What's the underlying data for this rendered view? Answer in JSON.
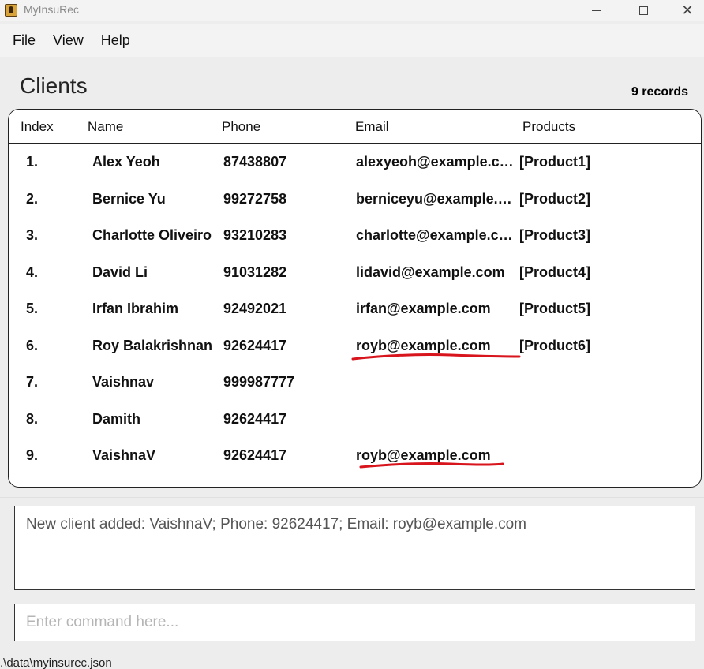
{
  "window": {
    "title": "MyInsuRec",
    "minimize_icon": "minimize-icon",
    "maximize_icon": "maximize-icon",
    "close_icon": "close-icon"
  },
  "menu": {
    "items": [
      "File",
      "View",
      "Help"
    ]
  },
  "clients_panel": {
    "title": "Clients",
    "record_count": "9 records",
    "columns": {
      "index": "Index",
      "name": "Name",
      "phone": "Phone",
      "email": "Email",
      "products": "Products"
    },
    "rows": [
      {
        "index": "1.",
        "name": "Alex Yeoh",
        "phone": "87438807",
        "email": "alexyeoh@example.com",
        "products": "[Product1]"
      },
      {
        "index": "2.",
        "name": "Bernice Yu",
        "phone": "99272758",
        "email": "berniceyu@example.com",
        "products": "[Product2]"
      },
      {
        "index": "3.",
        "name": "Charlotte Oliveiro",
        "phone": "93210283",
        "email": "charlotte@example.com",
        "products": "[Product3]"
      },
      {
        "index": "4.",
        "name": "David Li",
        "phone": "91031282",
        "email": "lidavid@example.com",
        "products": "[Product4]"
      },
      {
        "index": "5.",
        "name": "Irfan Ibrahim",
        "phone": "92492021",
        "email": "irfan@example.com",
        "products": "[Product5]"
      },
      {
        "index": "6.",
        "name": "Roy Balakrishnan",
        "phone": "92624417",
        "email": "royb@example.com",
        "products": "[Product6]"
      },
      {
        "index": "7.",
        "name": "Vaishnav",
        "phone": "999987777",
        "email": "",
        "products": ""
      },
      {
        "index": "8.",
        "name": "Damith",
        "phone": "92624417",
        "email": "",
        "products": ""
      },
      {
        "index": "9.",
        "name": "VaishnaV",
        "phone": "92624417",
        "email": "royb@example.com",
        "products": ""
      }
    ],
    "annotation_color": "#d8141c"
  },
  "result": {
    "text": "New client added: VaishnaV; Phone: 92624417; Email: royb@example.com"
  },
  "command": {
    "placeholder": "Enter command here..."
  },
  "status_bar": {
    "path": ".\\data\\myinsurec.json"
  }
}
